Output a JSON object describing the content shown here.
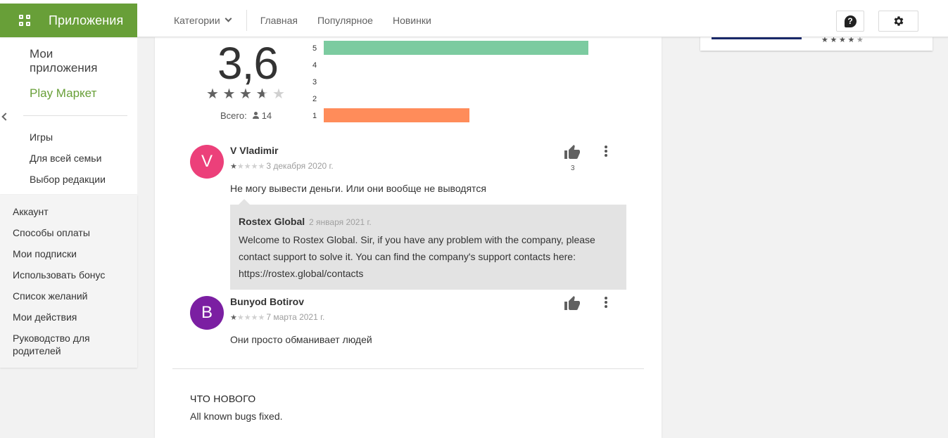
{
  "header": {
    "apps_label": "Приложения",
    "nav": {
      "categories": "Категории",
      "home": "Главная",
      "popular": "Популярное",
      "new": "Новинки"
    },
    "help_icon": "question-icon",
    "settings_icon": "gear-icon"
  },
  "sidebar": {
    "my_apps": "Мои приложения",
    "play_market": "Play Маркет",
    "items": [
      "Игры",
      "Для всей семьи",
      "Выбор редакции"
    ],
    "account_items": [
      "Аккаунт",
      "Способы оплаты",
      "Мои подписки",
      "Использовать бонус",
      "Список желаний",
      "Мои действия",
      "Руководство для родителей"
    ]
  },
  "rating": {
    "score": "3,6",
    "stars_value": 3.5,
    "stars_max": 5,
    "total_label": "Всего:",
    "total_count": "14",
    "histogram": [
      {
        "label": "5",
        "fraction": 0.69,
        "color": "#7ccba0"
      },
      {
        "label": "4",
        "fraction": 0,
        "color": "#b3d66f"
      },
      {
        "label": "3",
        "fraction": 0,
        "color": "#ffd54f"
      },
      {
        "label": "2",
        "fraction": 0,
        "color": "#ffb74d"
      },
      {
        "label": "1",
        "fraction": 0.38,
        "color": "#ff8c5a"
      }
    ]
  },
  "reviews": [
    {
      "initial": "V",
      "avatar_color": "#ec407a",
      "name": "V Vladimir",
      "stars": 1,
      "date": "3 декабря 2020 г.",
      "text": "Не могу вывести деньги. Или они вообще не выводятся",
      "likes": "3",
      "reply": {
        "developer": "Rostex Global",
        "date": "2 января 2021 г.",
        "text": "Welcome to Rostex Global. Sir, if you have any problem with the company, please contact support to solve it. You can find the company's support contacts here: https://rostex.global/contacts"
      }
    },
    {
      "initial": "B",
      "avatar_color": "#7b1fa2",
      "name": "Bunyod Botirov",
      "stars": 1,
      "date": "7 марта 2021 г.",
      "text": "Они просто обманивает людей",
      "likes": ""
    }
  ],
  "whats_new": {
    "title": "ЧТО НОВОГО",
    "text": "All known bugs fixed."
  },
  "right_card": {
    "stars_value": 4.5
  }
}
